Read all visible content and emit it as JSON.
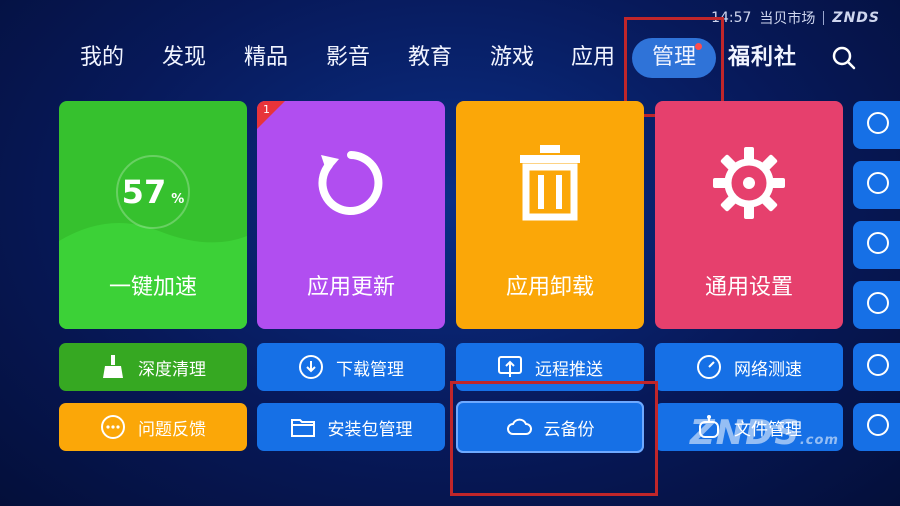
{
  "status_bar": {
    "time": "14:57",
    "store": "当贝市场",
    "brand": "ZNDS"
  },
  "nav": {
    "tabs": [
      "我的",
      "发现",
      "精品",
      "影音",
      "教育",
      "游戏",
      "应用",
      "管理"
    ],
    "special_tab": "福利社",
    "active_tab": "管理"
  },
  "cards": {
    "speed": {
      "label": "一键加速",
      "percent": "57",
      "percent_unit": "%"
    },
    "update": {
      "label": "应用更新",
      "badge": "1"
    },
    "uninstall": {
      "label": "应用卸载"
    },
    "settings": {
      "label": "通用设置"
    }
  },
  "tools": {
    "deep_clean": "深度清理",
    "download_mgr": "下载管理",
    "remote_push": "远程推送",
    "speed_test": "网络测速",
    "feedback": "问题反馈",
    "apk_mgr": "安装包管理",
    "cloud_backup": "云备份",
    "file_mgr": "文件管理"
  },
  "watermark": {
    "text": "ZNDS",
    "suffix": ".com"
  },
  "colors": {
    "green": "#36c12e",
    "purple": "#b14ef0",
    "orange": "#fba708",
    "pink": "#e6406d",
    "blue": "#1670e6",
    "highlight": "#c0262a"
  }
}
